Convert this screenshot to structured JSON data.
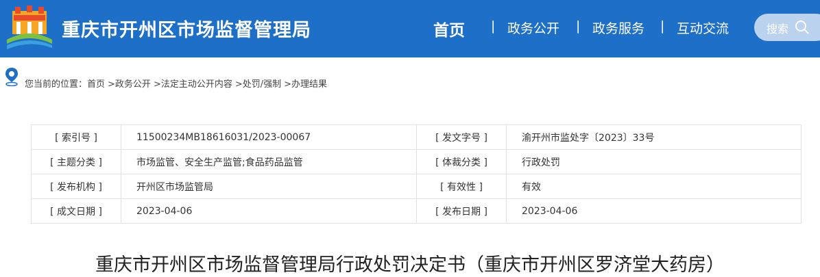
{
  "header": {
    "site_title": "重庆市开州区市场监督管理局",
    "nav": [
      "首页",
      "政务公开",
      "政务服务",
      "互动交流"
    ],
    "separator": "|",
    "search_label": "搜索"
  },
  "breadcrumb": {
    "prefix": "您当前的位置：",
    "items": [
      "首页",
      ">政务公开",
      ">法定主动公开内容",
      ">处罚/强制",
      ">办理结果"
    ]
  },
  "meta": {
    "rows": [
      {
        "l1": "[ 索引号 ]",
        "v1": "11500234MB18616031/2023-00067",
        "l2": "[ 发文字号 ]",
        "v2": "渝开州市监处字〔2023〕33号"
      },
      {
        "l1": "[ 主题分类 ]",
        "v1": "市场监管、安全生产监管;食品药品监管",
        "l2": "[ 体裁分类 ]",
        "v2": "行政处罚"
      },
      {
        "l1": "[ 发布机构 ]",
        "v1": "开州区市场监管局",
        "l2": "[ 有效性 ]",
        "v2": "有效"
      },
      {
        "l1": "[ 成文日期 ]",
        "v1": "2023-04-06",
        "l2": "[ 发布日期 ]",
        "v2": "2023-04-06"
      }
    ]
  },
  "document": {
    "title": "重庆市开州区市场监督管理局行政处罚决定书（重庆市开州区罗济堂大药房）"
  },
  "colors": {
    "header_bg": "#1e6fc7",
    "accent": "#1e6fc7"
  }
}
